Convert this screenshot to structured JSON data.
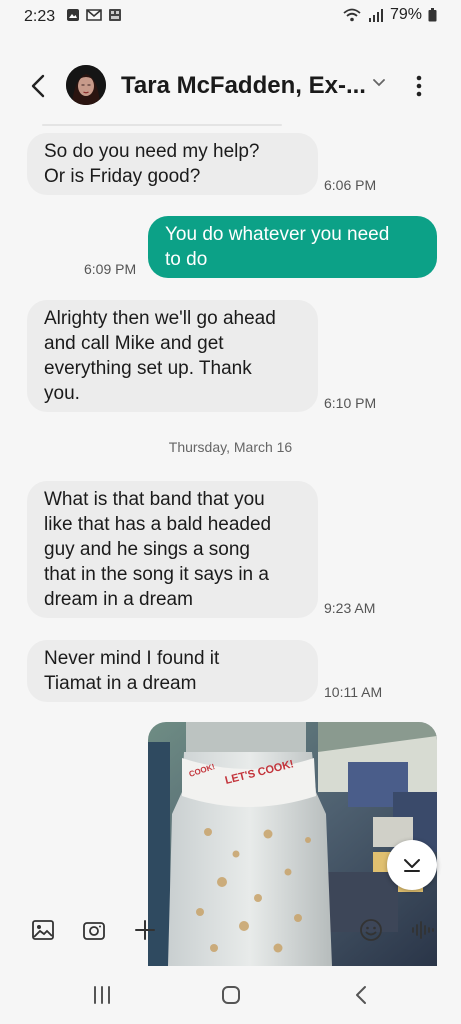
{
  "status_bar": {
    "time": "2:23",
    "battery": "79%"
  },
  "header": {
    "contact_name": "Tara McFadden, Ex-..."
  },
  "messages": [
    {
      "text": "So do you need my help?\nOr is Friday good?",
      "time": "6:06 PM"
    },
    {
      "text": "You do whatever you need\nto do",
      "time": "6:09 PM"
    },
    {
      "text": "Alrighty then we'll go ahead\nand call Mike and get\neverything set up. Thank\nyou.",
      "time": "6:10 PM"
    },
    {
      "text": "What is that band that you\nlike that has a bald headed\nguy and he sings a song\nthat in the song it says in a\ndream in a dream",
      "time": "9:23 AM"
    },
    {
      "text": "Never mind I found it\nTiamat in a dream",
      "time": "10:11 AM"
    }
  ],
  "date_divider": "Thursday, March 16",
  "photo": {
    "label_text": "LET'S COOK!"
  },
  "composer": {
    "placeholder": ""
  },
  "colors": {
    "outgoing_bubble": "#0ca187",
    "incoming_bubble": "#ececec",
    "background": "#f6f6f6"
  },
  "icons": [
    "back-icon",
    "chevron-down-icon",
    "more-vertical-icon",
    "gallery-icon",
    "camera-icon",
    "plus-icon",
    "emoji-icon",
    "voice-icon",
    "scroll-down-icon",
    "recents-icon",
    "home-icon",
    "nav-back-icon"
  ]
}
